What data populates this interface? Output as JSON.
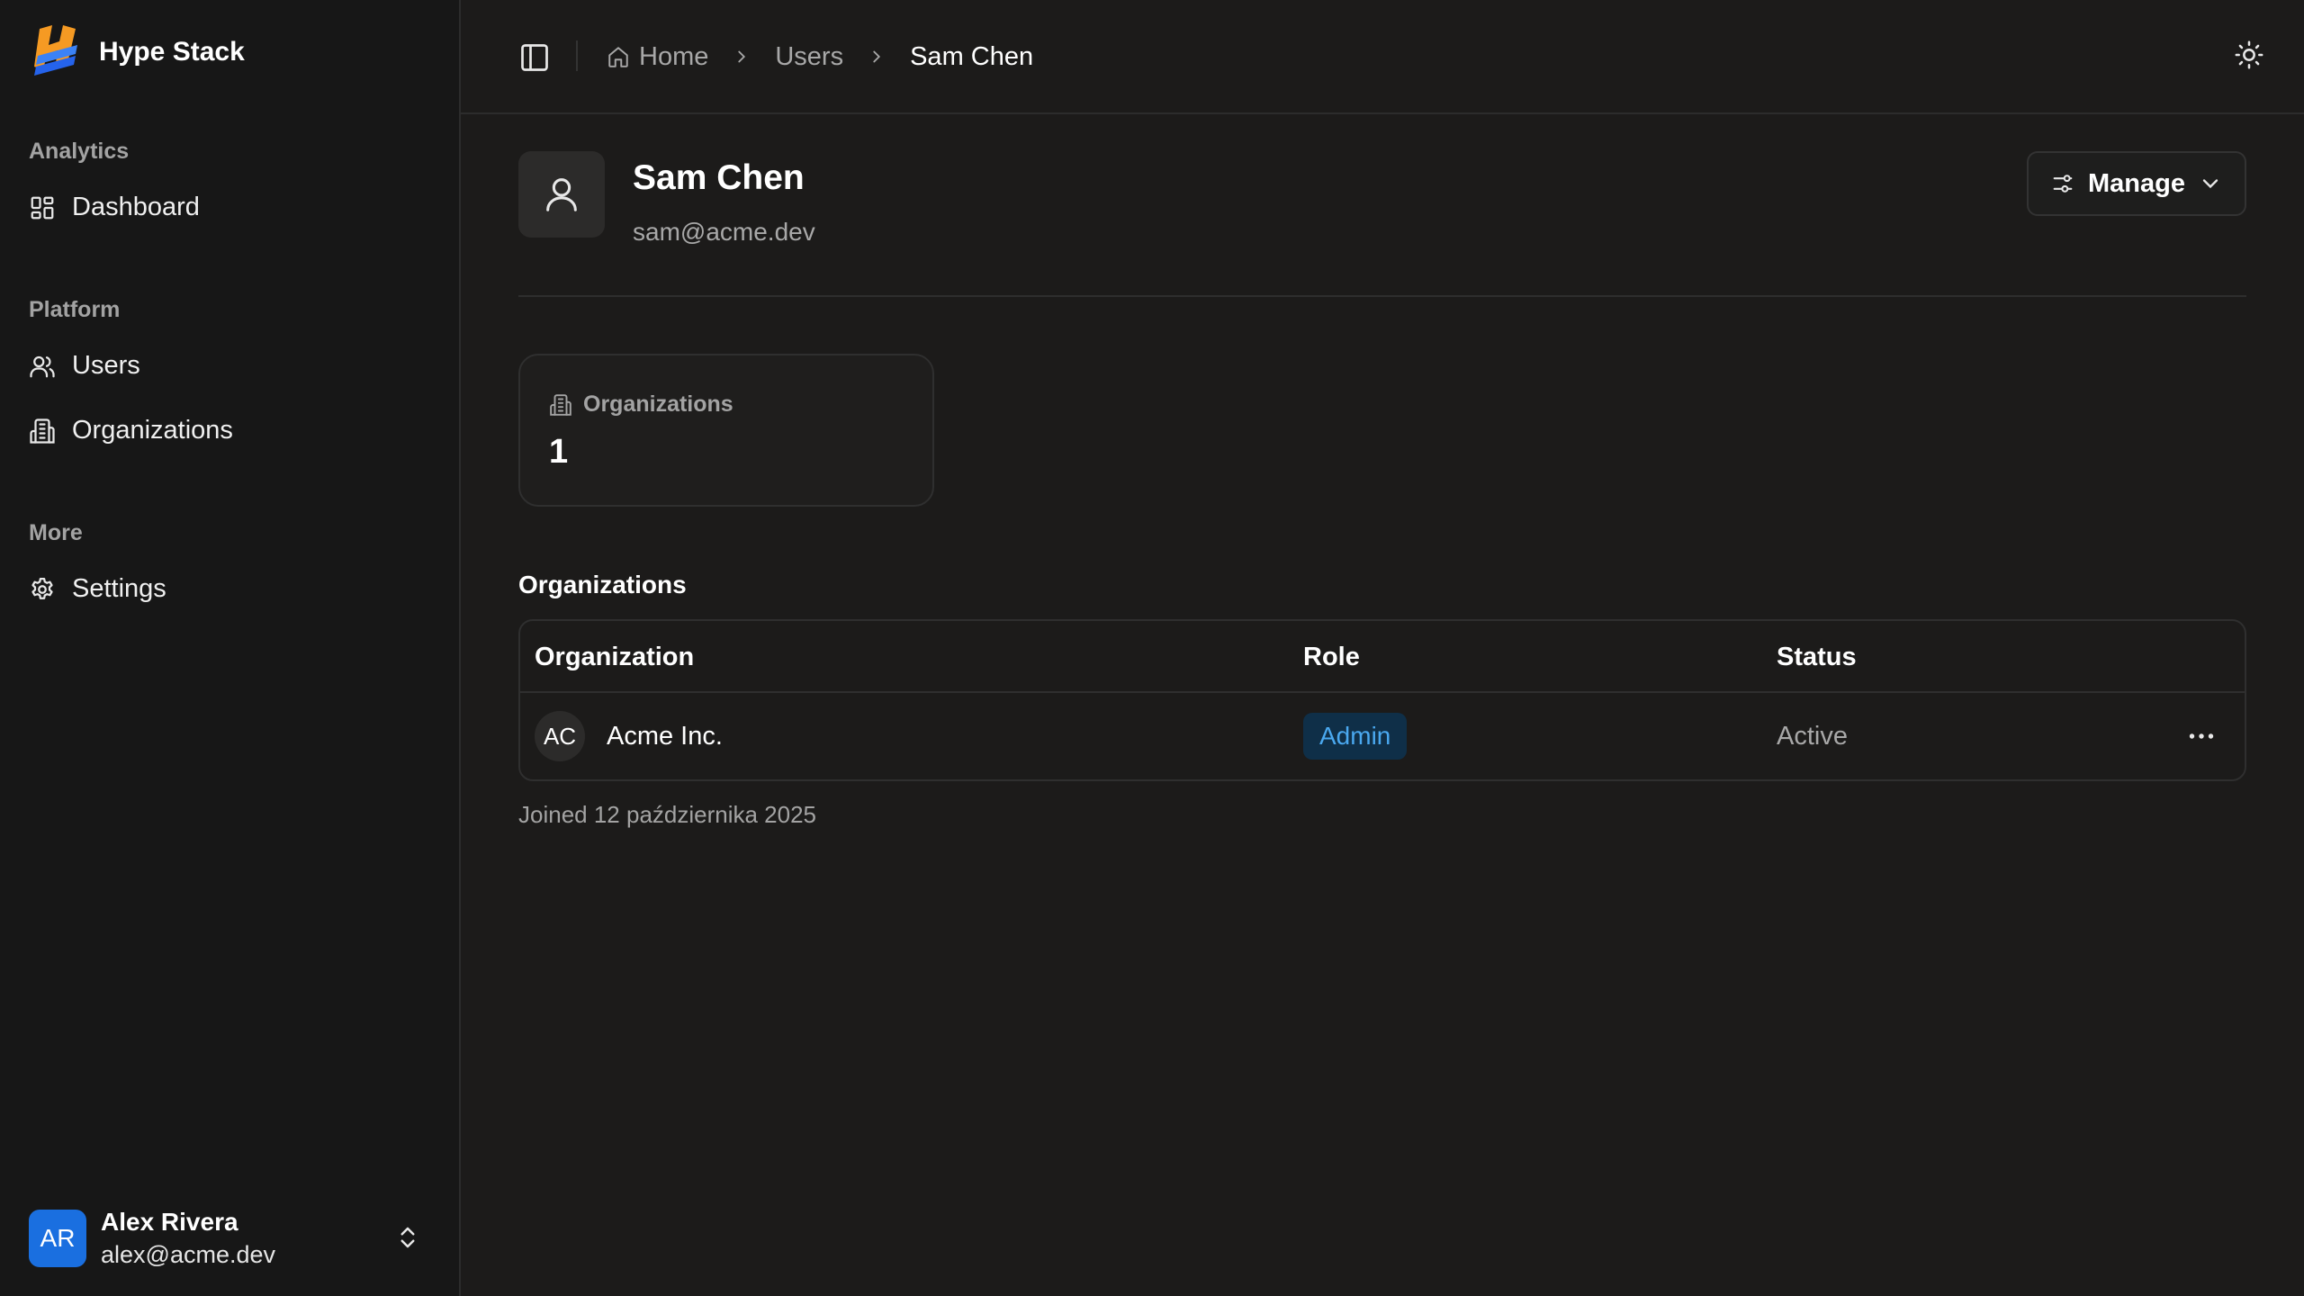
{
  "app": {
    "name": "Hype Stack"
  },
  "sidebar": {
    "groups": [
      {
        "label": "Analytics",
        "items": [
          {
            "label": "Dashboard",
            "icon": "dashboard-icon"
          }
        ]
      },
      {
        "label": "Platform",
        "items": [
          {
            "label": "Users",
            "icon": "users-icon"
          },
          {
            "label": "Organizations",
            "icon": "building-icon"
          }
        ]
      },
      {
        "label": "More",
        "items": [
          {
            "label": "Settings",
            "icon": "gear-icon"
          }
        ]
      }
    ],
    "user": {
      "initials": "AR",
      "name": "Alex Rivera",
      "email": "alex@acme.dev"
    }
  },
  "breadcrumb": {
    "home": "Home",
    "users": "Users",
    "current": "Sam Chen"
  },
  "profile": {
    "name": "Sam Chen",
    "email": "sam@acme.dev",
    "manage_label": "Manage"
  },
  "stats": {
    "organizations_label": "Organizations",
    "organizations_value": "1"
  },
  "orgs_section": {
    "title": "Organizations",
    "columns": [
      "Organization",
      "Role",
      "Status"
    ],
    "rows": [
      {
        "initials": "AC",
        "name": "Acme Inc.",
        "role": "Admin",
        "status": "Active"
      }
    ]
  },
  "joined_text": "Joined 12 października 2025",
  "colors": {
    "accent": "#1a6fe0",
    "role_badge_bg": "#0f2f48",
    "role_badge_text": "#4aa8ef",
    "background": "#1c1b1a",
    "sidebar_bg": "#171717"
  }
}
